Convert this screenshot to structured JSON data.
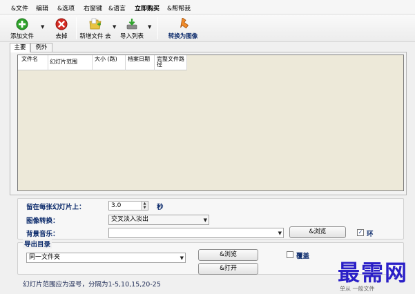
{
  "menu": {
    "items": [
      "&文件",
      "编辑",
      "&选项",
      "右窗键",
      "&语言",
      "立即购买",
      "&帮帮我"
    ]
  },
  "toolbar": {
    "add_label": "添加文件",
    "remove_label": "去掉",
    "new_folder_label": "新增文件 去",
    "import_label": "导入列表",
    "convert_label": "转换为图像"
  },
  "tabs": [
    "主要",
    "例外"
  ],
  "list": {
    "columns": [
      "文件名",
      "幻灯片范围",
      "大小 (路)",
      "档案日期",
      "完整文件路径"
    ]
  },
  "settings": {
    "stay_label": "留在每张幻灯片上：",
    "stay_value": "3.0",
    "stay_unit": "秒",
    "transition_label": "图像转换：",
    "transition_value": "交叉淡入淡出",
    "music_label": "背景音乐：",
    "music_value": "",
    "browse_label": "&浏览",
    "loop_label": "环",
    "loop_checked": true
  },
  "output": {
    "title": "导出目录",
    "dir_value": "同一文件夹",
    "browse_label": "&浏览",
    "open_label": "&打开",
    "overwrite_label": "覆盖",
    "overwrite_checked": false
  },
  "status": {
    "text": "幻灯片范围应为逗号，分隔为1-5,10,15,20-25"
  },
  "watermark": {
    "text": "最需网",
    "sub": "单从 一般文件"
  }
}
